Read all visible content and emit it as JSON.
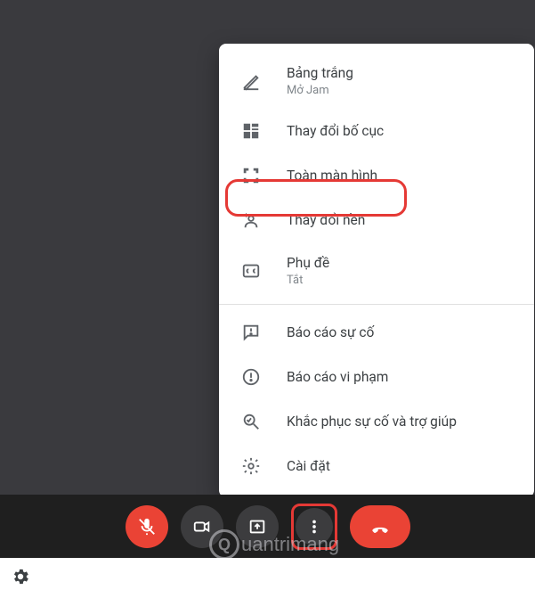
{
  "menu": {
    "whiteboard": {
      "label": "Bảng trắng",
      "sublabel": "Mở Jam"
    },
    "layout": {
      "label": "Thay đổi bố cục"
    },
    "fullscreen": {
      "label": "Toàn màn hình"
    },
    "background": {
      "label": "Thay đổi nền"
    },
    "captions": {
      "label": "Phụ đề",
      "sublabel": "Tắt"
    },
    "report": {
      "label": "Báo cáo sự cố"
    },
    "abuse": {
      "label": "Báo cáo vi phạm"
    },
    "help": {
      "label": "Khắc phục sự cố và trợ giúp"
    },
    "settings": {
      "label": "Cài đặt"
    }
  },
  "watermark": "uantrimang"
}
